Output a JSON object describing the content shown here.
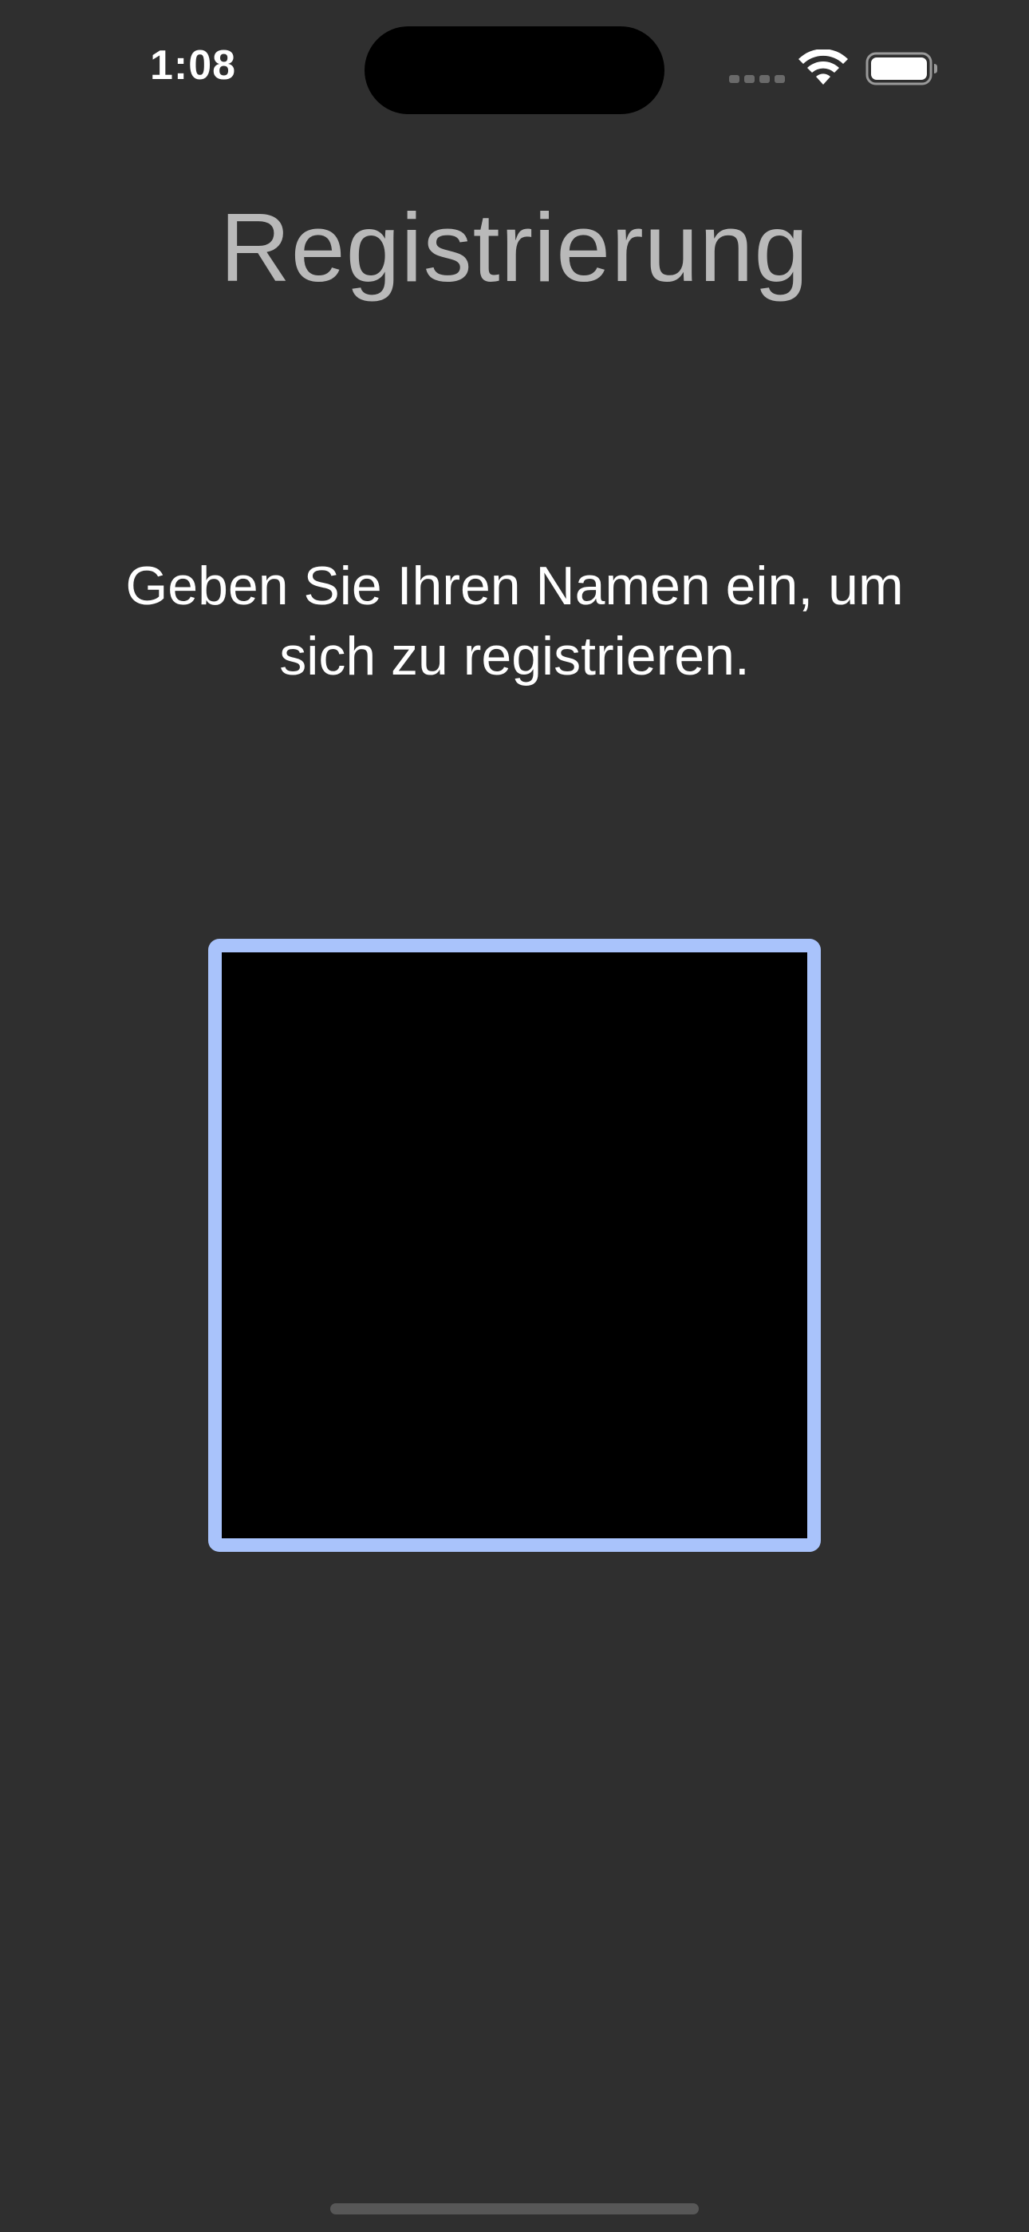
{
  "status_bar": {
    "time": "1:08",
    "icons": [
      "signal-icon",
      "wifi-icon",
      "battery-icon"
    ]
  },
  "page": {
    "title": "Registrierung",
    "instruction": "Geben Sie Ihren Namen ein, um sich zu registrieren."
  },
  "name_field": {
    "value": "",
    "placeholder": ""
  },
  "colors": {
    "background": "#2f2f2f",
    "title": "#b9b9b9",
    "field_border": "#a9c3fb",
    "field_fill": "#000000"
  }
}
